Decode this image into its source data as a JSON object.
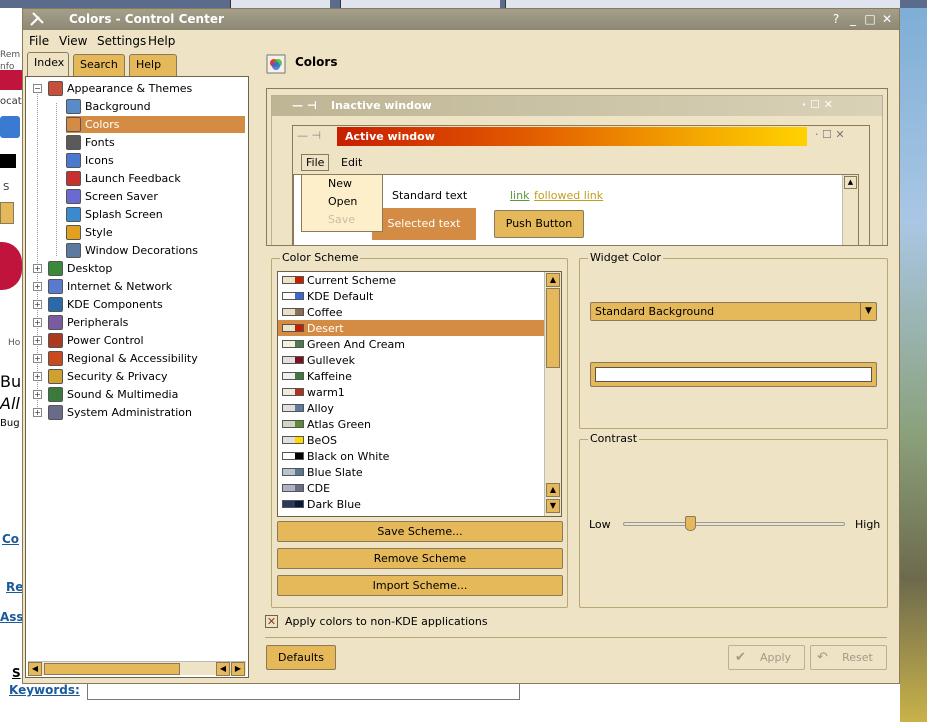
{
  "window": {
    "title": "Colors - Control Center",
    "help_glyph": "?",
    "minimize_glyph": "_",
    "maximize_glyph": "□",
    "close_glyph": "✕"
  },
  "menubar": {
    "file": "File",
    "view": "View",
    "settings": "Settings",
    "help": "Help"
  },
  "tabs": [
    "Index",
    "Search",
    "Help"
  ],
  "tree": [
    {
      "label": "Appearance & Themes",
      "level": 0,
      "expander": "−",
      "icon": "appearance-icon"
    },
    {
      "label": "Background",
      "level": 1,
      "icon": "background-icon"
    },
    {
      "label": "Colors",
      "level": 1,
      "icon": "colors-icon",
      "selected": true
    },
    {
      "label": "Fonts",
      "level": 1,
      "icon": "fonts-icon"
    },
    {
      "label": "Icons",
      "level": 1,
      "icon": "icons-icon"
    },
    {
      "label": "Launch Feedback",
      "level": 1,
      "icon": "launch-feedback-icon"
    },
    {
      "label": "Screen Saver",
      "level": 1,
      "icon": "screen-saver-icon"
    },
    {
      "label": "Splash Screen",
      "level": 1,
      "icon": "splash-screen-icon"
    },
    {
      "label": "Style",
      "level": 1,
      "icon": "style-icon"
    },
    {
      "label": "Window Decorations",
      "level": 1,
      "icon": "window-decorations-icon"
    },
    {
      "label": "Desktop",
      "level": 0,
      "expander": "+",
      "icon": "desktop-icon"
    },
    {
      "label": "Internet & Network",
      "level": 0,
      "expander": "+",
      "icon": "network-icon"
    },
    {
      "label": "KDE Components",
      "level": 0,
      "expander": "+",
      "icon": "kde-components-icon"
    },
    {
      "label": "Peripherals",
      "level": 0,
      "expander": "+",
      "icon": "peripherals-icon"
    },
    {
      "label": "Power Control",
      "level": 0,
      "expander": "+",
      "icon": "power-icon"
    },
    {
      "label": "Regional & Accessibility",
      "level": 0,
      "expander": "+",
      "icon": "regional-icon"
    },
    {
      "label": "Security & Privacy",
      "level": 0,
      "expander": "+",
      "icon": "security-icon"
    },
    {
      "label": "Sound & Multimedia",
      "level": 0,
      "expander": "+",
      "icon": "sound-icon"
    },
    {
      "label": "System Administration",
      "level": 0,
      "expander": "+",
      "icon": "system-admin-icon"
    }
  ],
  "content": {
    "title": "Colors"
  },
  "preview": {
    "inactive_title": "Inactive window",
    "active_title": "Active window",
    "menu_file": "File",
    "menu_edit": "Edit",
    "popup_new": "New",
    "popup_open": "Open",
    "popup_save": "Save",
    "standard_text": "Standard text",
    "link": "link",
    "followed_link": "followed link",
    "selected_text": "Selected text",
    "push_button": "Push Button"
  },
  "color_scheme": {
    "title": "Color Scheme",
    "items": [
      {
        "label": "Current Scheme",
        "colors": [
          "#efe3c6",
          "#c81e00"
        ]
      },
      {
        "label": "KDE Default",
        "colors": [
          "#ffffff",
          "#3a6ad0"
        ]
      },
      {
        "label": "Coffee",
        "colors": [
          "#e9dfc9",
          "#8a7052"
        ]
      },
      {
        "label": "Desert",
        "colors": [
          "#efe3c6",
          "#c81e00"
        ],
        "selected": true
      },
      {
        "label": "Green And Cream",
        "colors": [
          "#f4f1dc",
          "#4f7b4b"
        ]
      },
      {
        "label": "Gullevek",
        "colors": [
          "#e0e0e0",
          "#7a1020"
        ]
      },
      {
        "label": "Kaffeine",
        "colors": [
          "#efefef",
          "#3c7a3c"
        ]
      },
      {
        "label": "warm1",
        "colors": [
          "#f0eadc",
          "#b03020"
        ]
      },
      {
        "label": "Alloy",
        "colors": [
          "#e0e0e0",
          "#5a7aa0"
        ]
      },
      {
        "label": "Atlas Green",
        "colors": [
          "#cfd6c4",
          "#5a8a3a"
        ]
      },
      {
        "label": "BeOS",
        "colors": [
          "#e0e0e0",
          "#ffd800"
        ]
      },
      {
        "label": "Black on White",
        "colors": [
          "#ffffff",
          "#000000"
        ]
      },
      {
        "label": "Blue Slate",
        "colors": [
          "#b8c4cc",
          "#5a7890"
        ]
      },
      {
        "label": "CDE",
        "colors": [
          "#aeb2c3",
          "#6a6e88"
        ]
      },
      {
        "label": "Dark Blue",
        "colors": [
          "#2a3a5a",
          "#0a1a3a"
        ]
      }
    ],
    "save_label": "Save Scheme...",
    "remove_label": "Remove Scheme",
    "import_label": "Import Scheme..."
  },
  "widget_color": {
    "title": "Widget Color",
    "selected_value": "Standard Background",
    "swatch_color": "#ffffff"
  },
  "contrast": {
    "title": "Contrast",
    "low_label": "Low",
    "high_label": "High",
    "value_fraction": 0.3
  },
  "apply_checkbox": {
    "label": "Apply colors to non-KDE applications",
    "checked": true,
    "mark": "✕"
  },
  "buttons": {
    "defaults": "Defaults",
    "apply": "Apply",
    "reset": "Reset"
  },
  "background_page": {
    "keywords_label": "Keywords",
    "keywords_colon": ":",
    "fragments": [
      "Rem",
      "nfo",
      "ocati",
      "S",
      "Ho",
      "Bu",
      "All",
      "Bug",
      "Co",
      "Re",
      "Ass",
      "S"
    ]
  },
  "colors": {
    "accent": "#d48c45",
    "button": "#e5b85a",
    "window_bg": "#efe3c6"
  }
}
